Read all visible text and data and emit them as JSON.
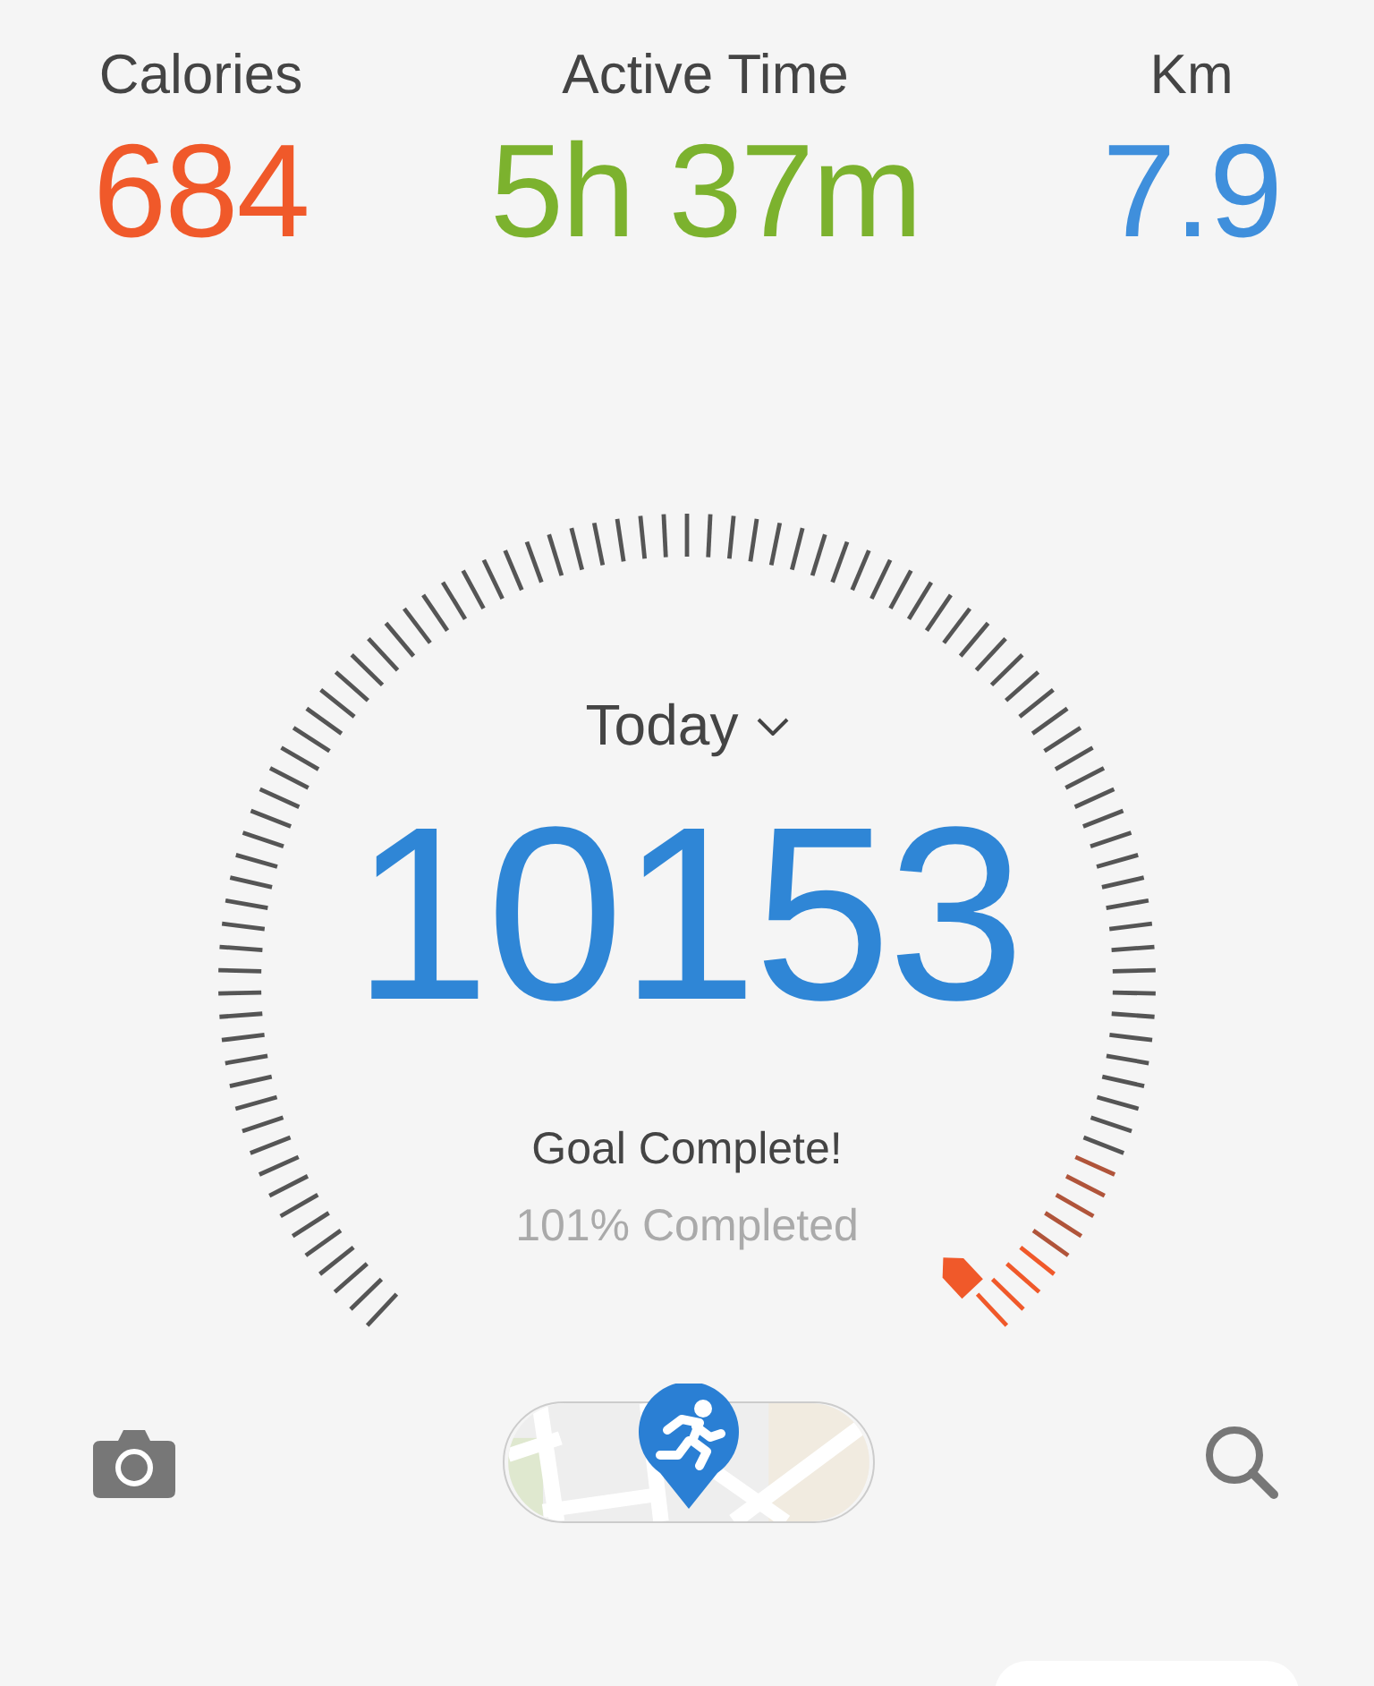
{
  "stats": [
    {
      "label": "Calories",
      "value": "684",
      "color": "#f0592a"
    },
    {
      "label": "Active Time",
      "value": "5h 37m",
      "color": "#7cb22e"
    },
    {
      "label": "Km",
      "value": "7.9",
      "color": "#3f8fdc"
    }
  ],
  "gauge": {
    "period": "Today",
    "steps": "10153",
    "status": "Goal Complete!",
    "progress": "101% Completed"
  }
}
